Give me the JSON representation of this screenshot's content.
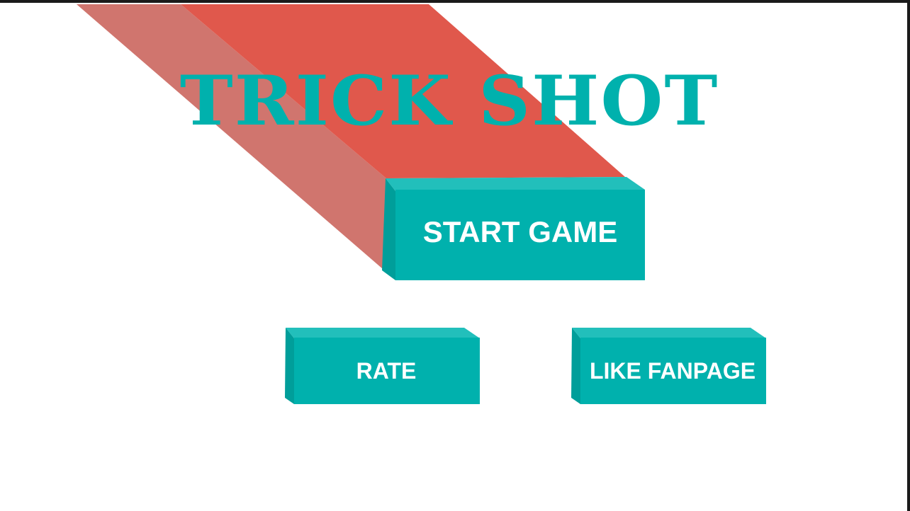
{
  "game": {
    "title": "TRICK SHOT"
  },
  "menu": {
    "start_label": "START GAME",
    "rate_label": "RATE",
    "fanpage_label": "LIKE FANPAGE"
  },
  "colors": {
    "accent": "#00b1ad",
    "accent_top": "#22bfbb",
    "accent_side": "#009e9a",
    "beam_main": "#e0584c",
    "beam_shadow": "#d0756e",
    "background": "#ffffff"
  }
}
